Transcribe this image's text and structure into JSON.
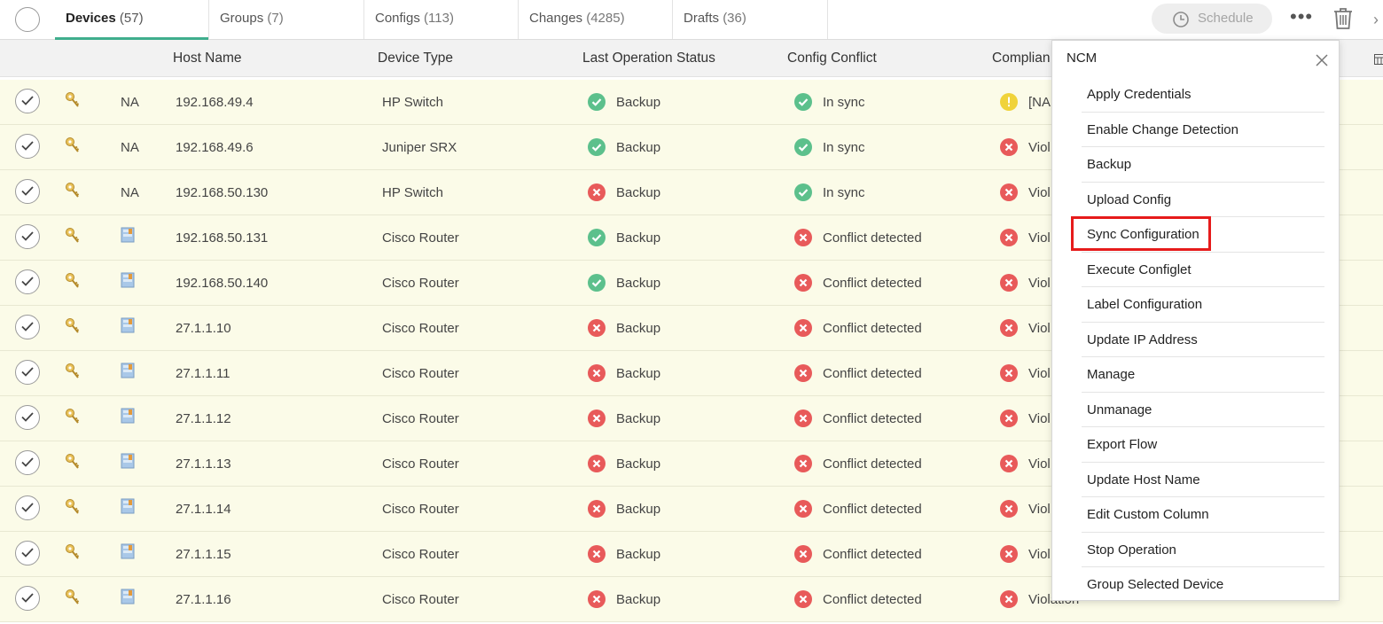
{
  "tabs": [
    {
      "label": "Devices",
      "count": "(57)",
      "active": true
    },
    {
      "label": "Groups",
      "count": "(7)",
      "active": false
    },
    {
      "label": "Configs",
      "count": "(113)",
      "active": false
    },
    {
      "label": "Changes",
      "count": "(4285)",
      "active": false
    },
    {
      "label": "Drafts",
      "count": "(36)",
      "active": false
    }
  ],
  "toolbar": {
    "schedule_label": "Schedule"
  },
  "columns": {
    "host_name": "Host Name",
    "device_type": "Device Type",
    "last_op": "Last Operation Status",
    "conflict": "Config Conflict",
    "compliance": "Complian"
  },
  "rows": [
    {
      "type_label": "NA",
      "host": "192.168.49.4",
      "device_type": "HP Switch",
      "op_status": "ok",
      "op": "Backup",
      "conflict_status": "ok",
      "conflict": "In sync",
      "compliance_status": "warn",
      "compliance": "[NA"
    },
    {
      "type_label": "NA",
      "host": "192.168.49.6",
      "device_type": "Juniper SRX",
      "op_status": "ok",
      "op": "Backup",
      "conflict_status": "ok",
      "conflict": "In sync",
      "compliance_status": "err",
      "compliance": "Viol"
    },
    {
      "type_label": "NA",
      "host": "192.168.50.130",
      "device_type": "HP Switch",
      "op_status": "err",
      "op": "Backup",
      "conflict_status": "ok",
      "conflict": "In sync",
      "compliance_status": "err",
      "compliance": "Viol"
    },
    {
      "type_label": "",
      "host": "192.168.50.131",
      "device_type": "Cisco Router",
      "op_status": "ok",
      "op": "Backup",
      "conflict_status": "err",
      "conflict": "Conflict detected",
      "compliance_status": "err",
      "compliance": "Viol"
    },
    {
      "type_label": "",
      "host": "192.168.50.140",
      "device_type": "Cisco Router",
      "op_status": "ok",
      "op": "Backup",
      "conflict_status": "err",
      "conflict": "Conflict detected",
      "compliance_status": "err",
      "compliance": "Viol"
    },
    {
      "type_label": "",
      "host": "27.1.1.10",
      "device_type": "Cisco Router",
      "op_status": "err",
      "op": "Backup",
      "conflict_status": "err",
      "conflict": "Conflict detected",
      "compliance_status": "err",
      "compliance": "Viol"
    },
    {
      "type_label": "",
      "host": "27.1.1.11",
      "device_type": "Cisco Router",
      "op_status": "err",
      "op": "Backup",
      "conflict_status": "err",
      "conflict": "Conflict detected",
      "compliance_status": "err",
      "compliance": "Viol"
    },
    {
      "type_label": "",
      "host": "27.1.1.12",
      "device_type": "Cisco Router",
      "op_status": "err",
      "op": "Backup",
      "conflict_status": "err",
      "conflict": "Conflict detected",
      "compliance_status": "err",
      "compliance": "Viol"
    },
    {
      "type_label": "",
      "host": "27.1.1.13",
      "device_type": "Cisco Router",
      "op_status": "err",
      "op": "Backup",
      "conflict_status": "err",
      "conflict": "Conflict detected",
      "compliance_status": "err",
      "compliance": "Viol"
    },
    {
      "type_label": "",
      "host": "27.1.1.14",
      "device_type": "Cisco Router",
      "op_status": "err",
      "op": "Backup",
      "conflict_status": "err",
      "conflict": "Conflict detected",
      "compliance_status": "err",
      "compliance": "Viol"
    },
    {
      "type_label": "",
      "host": "27.1.1.15",
      "device_type": "Cisco Router",
      "op_status": "err",
      "op": "Backup",
      "conflict_status": "err",
      "conflict": "Conflict detected",
      "compliance_status": "err",
      "compliance": "Viol"
    },
    {
      "type_label": "",
      "host": "27.1.1.16",
      "device_type": "Cisco Router",
      "op_status": "err",
      "op": "Backup",
      "conflict_status": "err",
      "conflict": "Conflict detected",
      "compliance_status": "err",
      "compliance": "Violation"
    }
  ],
  "menu": {
    "title": "NCM",
    "highlighted_item": "Sync Configuration",
    "items": [
      "Apply Credentials",
      "Enable Change Detection",
      "Backup",
      "Upload Config",
      "Sync Configuration",
      "Execute Configlet",
      "Label Configuration",
      "Update IP Address",
      "Manage",
      "Unmanage",
      "Export Flow",
      "Update Host Name",
      "Edit Custom Column",
      "Stop Operation",
      "Group Selected Device"
    ]
  },
  "colors": {
    "accent": "#3fae8d",
    "ok": "#5cc08c",
    "error": "#e85a5a",
    "warning": "#f0d33a",
    "row_bg": "#fbfbe8",
    "highlight": "#e61b1b"
  }
}
